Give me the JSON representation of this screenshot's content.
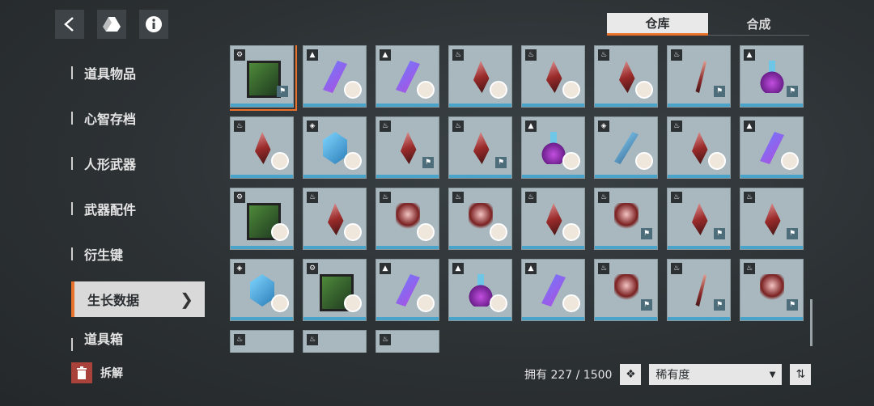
{
  "topbar": {
    "icons": [
      "back-icon",
      "drive-icon",
      "info-icon"
    ]
  },
  "tabs": [
    {
      "label": "仓库",
      "active": true
    },
    {
      "label": "合成",
      "active": false
    }
  ],
  "sidebar": {
    "items": [
      {
        "label": "道具物品"
      },
      {
        "label": "心智存档"
      },
      {
        "label": "人形武器"
      },
      {
        "label": "武器配件"
      },
      {
        "label": "衍生键"
      },
      {
        "label": "生长数据",
        "active": true
      },
      {
        "label": "道具箱"
      }
    ]
  },
  "breakdown": {
    "label": "拆解"
  },
  "footer": {
    "count": "拥有 227 / 1500",
    "sort": "稀有度"
  },
  "accent": "#e8712c"
}
